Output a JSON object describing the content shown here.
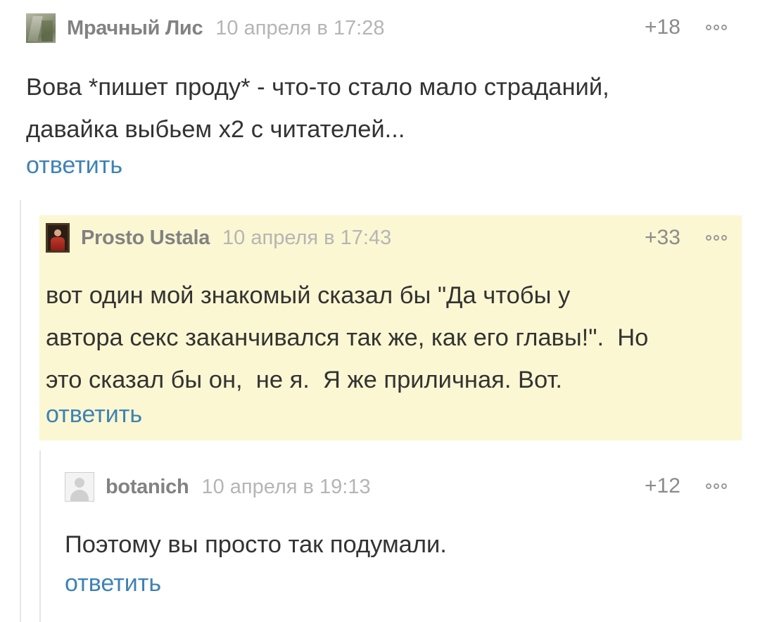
{
  "comments": [
    {
      "author": "Мрачный Лис",
      "date": "10 апреля в 17:28",
      "score": "+18",
      "avatar": "fox-avatar",
      "body": [
        "Вова *пишет проду* - что-то стало мало страданий,",
        "давайка выбьем х2 с читателей..."
      ],
      "reply": "ответить"
    },
    {
      "author": "Prosto Ustala",
      "date": "10 апреля в 17:43",
      "score": "+33",
      "avatar": "portrait-avatar",
      "highlight_color": "#fbf7d2",
      "body": [
        "вот один мой знакомый сказал бы \"Да чтобы у",
        "автора секс заканчивался так же, как его главы!\".  Но",
        "это сказал бы он,  не я.  Я же приличная. Вот."
      ],
      "reply": "ответить"
    },
    {
      "author": "botanich",
      "date": "10 апреля в 19:13",
      "score": "+12",
      "avatar": "default-avatar",
      "body": [
        "Поэтому вы просто так подумали."
      ],
      "reply": "ответить"
    }
  ],
  "colors": {
    "author": "#828282",
    "date": "#b5b5b5",
    "text": "#333333",
    "link": "#3d82b5"
  },
  "icons": {
    "more": "more-options-icon"
  }
}
